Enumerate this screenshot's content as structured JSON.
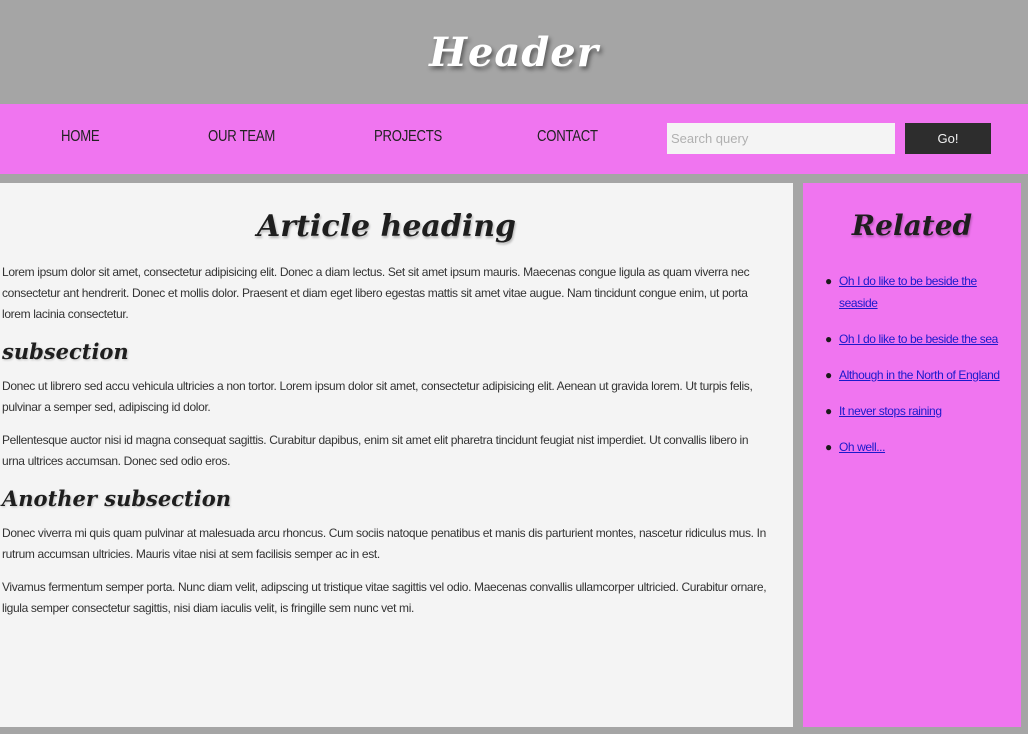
{
  "header": {
    "title": "Header"
  },
  "nav": {
    "items": [
      {
        "label": "HOME"
      },
      {
        "label": "OUR TEAM"
      },
      {
        "label": "PROJECTS"
      },
      {
        "label": "CONTACT"
      }
    ],
    "search": {
      "placeholder": "Search query",
      "value": ""
    },
    "go_label": "Go!"
  },
  "article": {
    "heading": "Article heading",
    "intro": "Lorem ipsum dolor sit amet, consectetur adipisicing elit. Donec a diam lectus. Set sit amet ipsum mauris. Maecenas congue ligula as quam viverra nec consectetur ant hendrerit. Donec et mollis dolor. Praesent et diam eget libero egestas mattis sit amet vitae augue. Nam tincidunt congue enim, ut porta lorem lacinia consectetur.",
    "subsection1": {
      "heading": "subsection",
      "paragraphs": [
        "Donec ut librero sed accu vehicula ultricies a non tortor. Lorem ipsum dolor sit amet, consectetur adipisicing elit. Aenean ut gravida lorem. Ut turpis felis, pulvinar a semper sed, adipiscing id dolor.",
        "Pellentesque auctor nisi id magna consequat sagittis. Curabitur dapibus, enim sit amet elit pharetra tincidunt feugiat nist imperdiet. Ut convallis libero in urna ultrices accumsan. Donec sed odio eros."
      ]
    },
    "subsection2": {
      "heading": "Another subsection",
      "paragraphs": [
        "Donec viverra mi quis quam pulvinar at malesuada arcu rhoncus. Cum sociis natoque penatibus et manis dis parturient montes, nascetur ridiculus mus. In rutrum accumsan ultricies. Mauris vitae nisi at sem facilisis semper ac in est.",
        "Vivamus fermentum semper porta. Nunc diam velit, adipscing ut tristique vitae sagittis vel odio. Maecenas convallis ullamcorper ultricied. Curabitur ornare, ligula semper consectetur sagittis, nisi diam iaculis velit, is fringille sem nunc vet mi."
      ]
    }
  },
  "sidebar": {
    "heading": "Related",
    "links": [
      {
        "label": "Oh I do like to be beside the seaside"
      },
      {
        "label": "Oh I do like to be beside the sea"
      },
      {
        "label": "Although in the North of England"
      },
      {
        "label": "It never stops raining"
      },
      {
        "label": "Oh well..."
      }
    ]
  },
  "colors": {
    "header_bg": "#a5a5a5",
    "nav_bg": "#f075f0",
    "article_bg": "#f4f4f4",
    "button_bg": "#2d2d2d",
    "link": "#1a1acc"
  }
}
